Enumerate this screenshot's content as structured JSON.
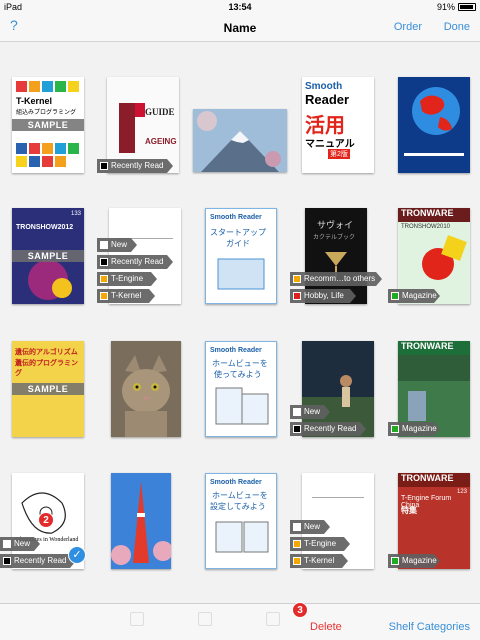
{
  "status_bar": {
    "device": "iPad",
    "time": "13:54",
    "battery": "91%"
  },
  "nav_bar": {
    "help": "?",
    "title": "Name",
    "order": "Order",
    "done": "Done"
  },
  "toolbar": {
    "delete": "Delete",
    "shelf_categories": "Shelf Categories"
  },
  "badges": {
    "badge2": "2",
    "badge3": "3"
  },
  "tags": {
    "recently_read": "Recently Read",
    "new": "New",
    "t_engine": "T-Engine",
    "t_kernel": "T-Kernel",
    "recomm_others": "Recomm…to others",
    "hobby_life": "Hobby, Life",
    "magazine": "Magazine",
    "sample": "SAMPLE"
  },
  "tag_colors": {
    "recently_read": "#000000",
    "new": "#ffffff",
    "t_engine": "#f5a800",
    "t_kernel": "#f5a800",
    "recomm_others": "#f5a800",
    "hobby_life": "#e02020",
    "magazine": "#22aa22"
  },
  "covers": {
    "tkernel_title": "T-Kernel",
    "tkernel_sub": "組込みプログラミング",
    "guide_g": "GUIDE",
    "guide_aging": "AGEING",
    "sr_smooth": "Smooth",
    "sr_reader": "Reader",
    "sr_katsuyo": "活用",
    "sr_manual": "マニュアル",
    "sr_ed2": "第2版",
    "tronshow": "TRONSHOW2012",
    "sr_startup_1": "スタートアップ",
    "sr_startup_2": "ガイド",
    "sr_smooth_reader": "Smooth Reader",
    "sawoi": "サヴォイ",
    "sawoi_sub": "カクテルブック",
    "tronware": "TRONWARE",
    "tronshow2010": "TRONSHOW2010",
    "idenshi_1": "遺伝的アルゴリズムと",
    "idenshi_2": "遺伝的プログラミング",
    "sr_home_1": "ホームビューを",
    "sr_home_2": "使ってみよう",
    "sr_home_3": "設定してみよう",
    "alice": "Adventures in Wonderland",
    "tronware_forum": "T-Engine Forum China",
    "tronware_forum_sub": "特集",
    "tronware_num": "123",
    "tronshow_num": "133"
  }
}
